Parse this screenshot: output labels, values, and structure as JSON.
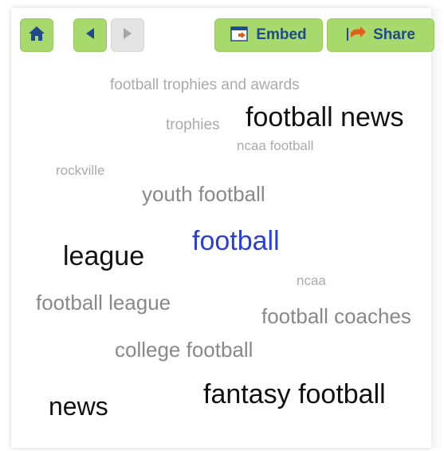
{
  "toolbar": {
    "home_icon": "home-icon",
    "back_icon": "arrow-left-icon",
    "forward_icon": "arrow-right-icon",
    "embed_label": "Embed",
    "embed_icon": "embed-icon",
    "share_label": "Share",
    "share_icon": "share-icon"
  },
  "colors": {
    "button_green": "#a7d96c",
    "button_disabled": "#e3e3e3",
    "label_blue": "#1f4b8c",
    "highlight_blue": "#2a3fd6"
  },
  "cloud": {
    "words": [
      {
        "text": "football trophies and awards",
        "color": "#aaaaaa"
      },
      {
        "text": "trophies",
        "color": "#aaaaaa"
      },
      {
        "text": "football news",
        "color": "#111111"
      },
      {
        "text": "ncaa football",
        "color": "#aaaaaa"
      },
      {
        "text": "rockville",
        "color": "#aaaaaa"
      },
      {
        "text": "youth football",
        "color": "#888888"
      },
      {
        "text": "league",
        "color": "#111111"
      },
      {
        "text": "football",
        "color": "#2a3fd6"
      },
      {
        "text": "ncaa",
        "color": "#aaaaaa"
      },
      {
        "text": "football league",
        "color": "#888888"
      },
      {
        "text": "football coaches",
        "color": "#888888"
      },
      {
        "text": "college football",
        "color": "#888888"
      },
      {
        "text": "news",
        "color": "#111111"
      },
      {
        "text": "fantasy football",
        "color": "#111111"
      }
    ]
  }
}
